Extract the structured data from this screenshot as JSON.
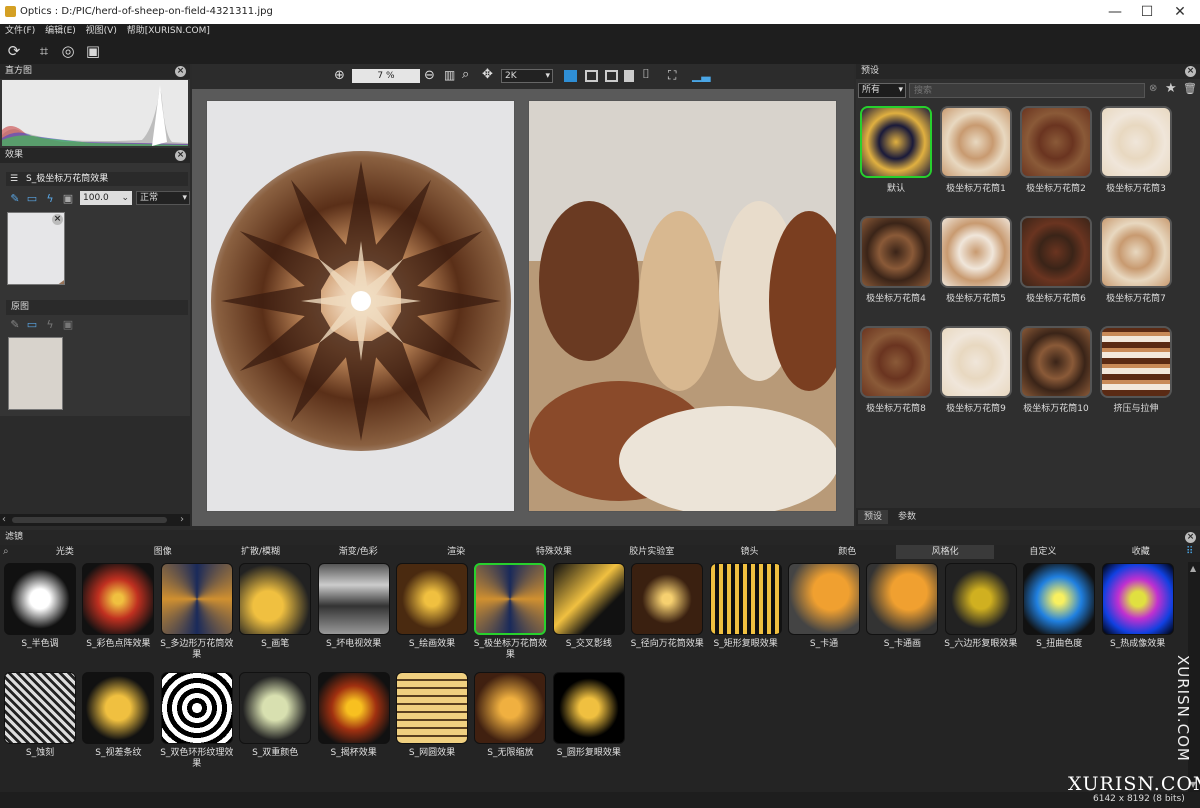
{
  "window": {
    "title": "Optics : D:/PIC/herd-of-sheep-on-field-4321311.jpg",
    "min": "—",
    "max": "☐",
    "close": "✕"
  },
  "menu": [
    "文件(F)",
    "编辑(E)",
    "视图(V)",
    "帮助[XURISN.COM]"
  ],
  "histogram": {
    "title": "直方图"
  },
  "effects": {
    "title": "效果",
    "layer_name": "S_极坐标万花筒效果",
    "opacity": "100.0",
    "blend_mode": "正常"
  },
  "original": {
    "title": "原图"
  },
  "viewer": {
    "zoom": "7 %",
    "resolution": "2K"
  },
  "presets": {
    "title": "预设",
    "category": "所有",
    "search_placeholder": "搜索",
    "items": [
      {
        "label": "默认",
        "selected": true
      },
      {
        "label": "极坐标万花筒1"
      },
      {
        "label": "极坐标万花筒2"
      },
      {
        "label": "极坐标万花筒3"
      },
      {
        "label": "极坐标万花筒4"
      },
      {
        "label": "极坐标万花筒5"
      },
      {
        "label": "极坐标万花筒6"
      },
      {
        "label": "极坐标万花筒7"
      },
      {
        "label": "极坐标万花筒8"
      },
      {
        "label": "极坐标万花筒9"
      },
      {
        "label": "极坐标万花筒10"
      },
      {
        "label": "挤压与拉伸"
      }
    ],
    "tabs": [
      "预设",
      "参数"
    ]
  },
  "filters": {
    "title": "滤镜",
    "tabs": [
      "光类",
      "图像",
      "扩散/模糊",
      "渐变/色彩",
      "渲染",
      "特殊效果",
      "胶片实验室",
      "镜头",
      "颜色",
      "风格化",
      "自定义",
      "收藏"
    ],
    "active_tab": "风格化",
    "items": [
      "S_半色调",
      "S_彩色点阵效果",
      "S_多边形万花筒效果",
      "S_画笔",
      "S_坏电视效果",
      "S_绘画效果",
      "S_极坐标万花筒效果",
      "S_交叉影线",
      "S_径向万花筒效果",
      "S_矩形复眼效果",
      "S_卡通",
      "S_卡通画",
      "S_六边形复眼效果",
      "S_扭曲色度",
      "S_热成像效果",
      "S_蚀刻",
      "S_视差条纹",
      "S_双色环形纹理效果",
      "S_双重颜色",
      "S_揭杯效果",
      "S_网圆效果",
      "S_无限缩放",
      "S_圆形复眼效果"
    ],
    "selected": "S_极坐标万花筒效果"
  },
  "status": {
    "size": "6142 x 8192 (8 bits)"
  },
  "watermark": {
    "side": "XURISN.COM",
    "bottom": "XURISN.COM"
  },
  "colors": {
    "accent_green": "#27d02d",
    "panel_bg": "#343434",
    "dark_bg": "#1e1e1e",
    "selection_blue": "#2f8fd6"
  }
}
